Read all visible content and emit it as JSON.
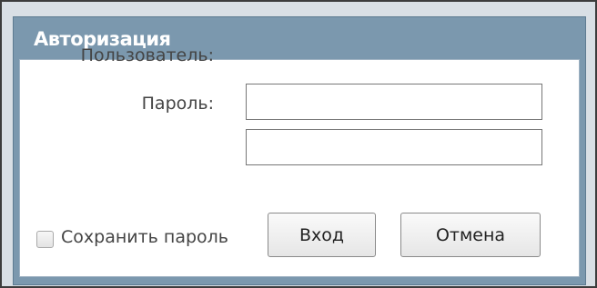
{
  "dialog": {
    "title": "Авторизация"
  },
  "form": {
    "user_label": "Пользователь:",
    "user_value": "",
    "password_label": "Пароль:",
    "password_value": ""
  },
  "remember": {
    "label": "Сохранить пароль",
    "checked": false
  },
  "buttons": {
    "login_label": "Вход",
    "cancel_label": "Отмена"
  }
}
